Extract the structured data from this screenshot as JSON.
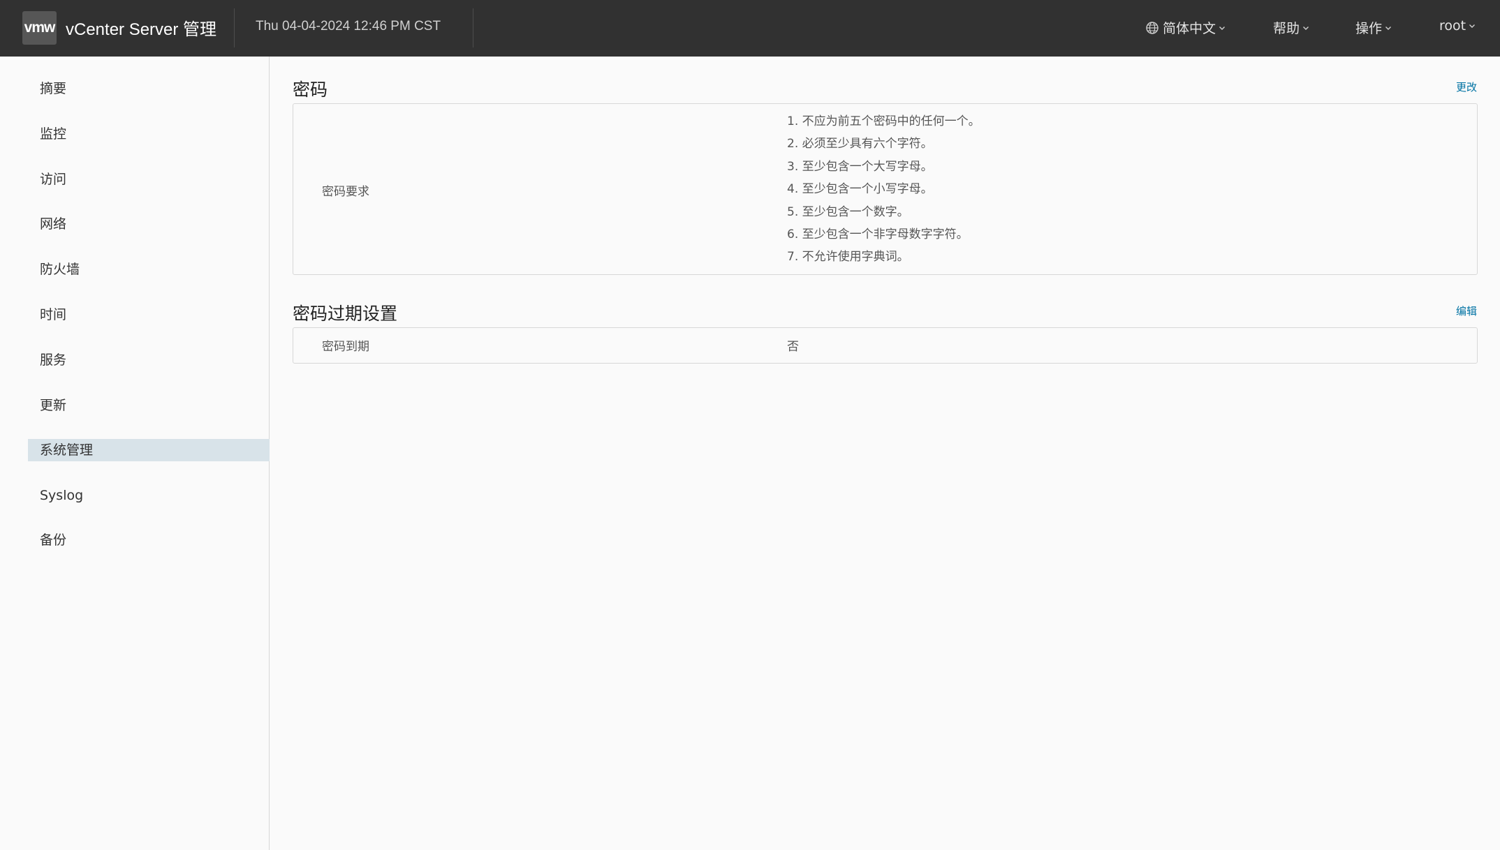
{
  "header": {
    "logo_text": "vmw",
    "app_title": "vCenter Server 管理",
    "datetime": "Thu 04-04-2024 12:46 PM CST",
    "menus": {
      "language": "简体中文",
      "help": "帮助",
      "actions": "操作",
      "user": "root"
    }
  },
  "sidebar": {
    "items": [
      {
        "label": "摘要",
        "active": false
      },
      {
        "label": "监控",
        "active": false
      },
      {
        "label": "访问",
        "active": false
      },
      {
        "label": "网络",
        "active": false
      },
      {
        "label": "防火墙",
        "active": false
      },
      {
        "label": "时间",
        "active": false
      },
      {
        "label": "服务",
        "active": false
      },
      {
        "label": "更新",
        "active": false
      },
      {
        "label": "系统管理",
        "active": true
      },
      {
        "label": "Syslog",
        "active": false
      },
      {
        "label": "备份",
        "active": false
      }
    ]
  },
  "password_section": {
    "title": "密码",
    "action_label": "更改",
    "requirements_label": "密码要求",
    "requirements": [
      "1. 不应为前五个密码中的任何一个。",
      "2. 必须至少具有六个字符。",
      "3. 至少包含一个大写字母。",
      "4. 至少包含一个小写字母。",
      "5. 至少包含一个数字。",
      "6. 至少包含一个非字母数字字符。",
      "7. 不允许使用字典词。"
    ]
  },
  "expiry_section": {
    "title": "密码过期设置",
    "action_label": "编辑",
    "expiry_label": "密码到期",
    "expiry_value": "否"
  },
  "colors": {
    "header_bg": "#313131",
    "active_nav_bg": "#d8e3e9",
    "link": "#0072a3"
  }
}
